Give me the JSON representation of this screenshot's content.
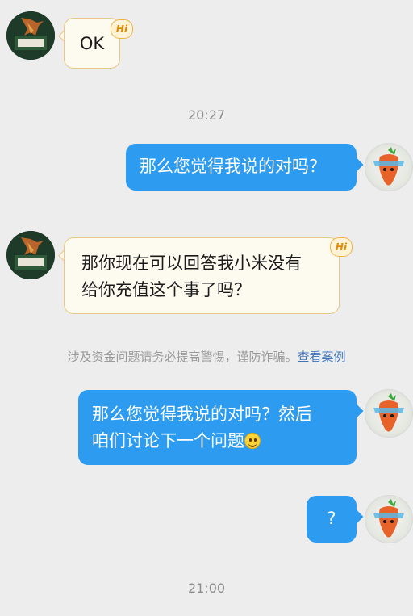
{
  "messages": [
    {
      "side": "in",
      "text": "OK"
    },
    {
      "side": "out",
      "text": "那么您觉得我说的对吗？"
    },
    {
      "side": "in",
      "line1": "那你现在可以回答我小米没有",
      "line2": "给你充值这个事了吗？"
    },
    {
      "side": "out",
      "line1": "那么您觉得我说的对吗？然后",
      "line2": "咱们讨论下一个问题"
    },
    {
      "side": "out",
      "text": "?"
    }
  ],
  "badge": {
    "label": "Hi"
  },
  "timestamps": {
    "t1": "20:27",
    "t2": "21:00"
  },
  "notice": {
    "text": "涉及资金问题请务必提高警惕，谨防诈骗。",
    "link": "查看案例"
  },
  "icons": {
    "left_avatar": "avatar-left-icon",
    "right_avatar": "avatar-right-carrot-icon",
    "emoji": "smile-emoji-icon"
  },
  "colors": {
    "background": "#ededed",
    "outgoing_bubble": "#2d9bf0",
    "incoming_bubble": "#fdfaf0",
    "incoming_border": "#e8c88a",
    "link": "#3f73b5"
  }
}
